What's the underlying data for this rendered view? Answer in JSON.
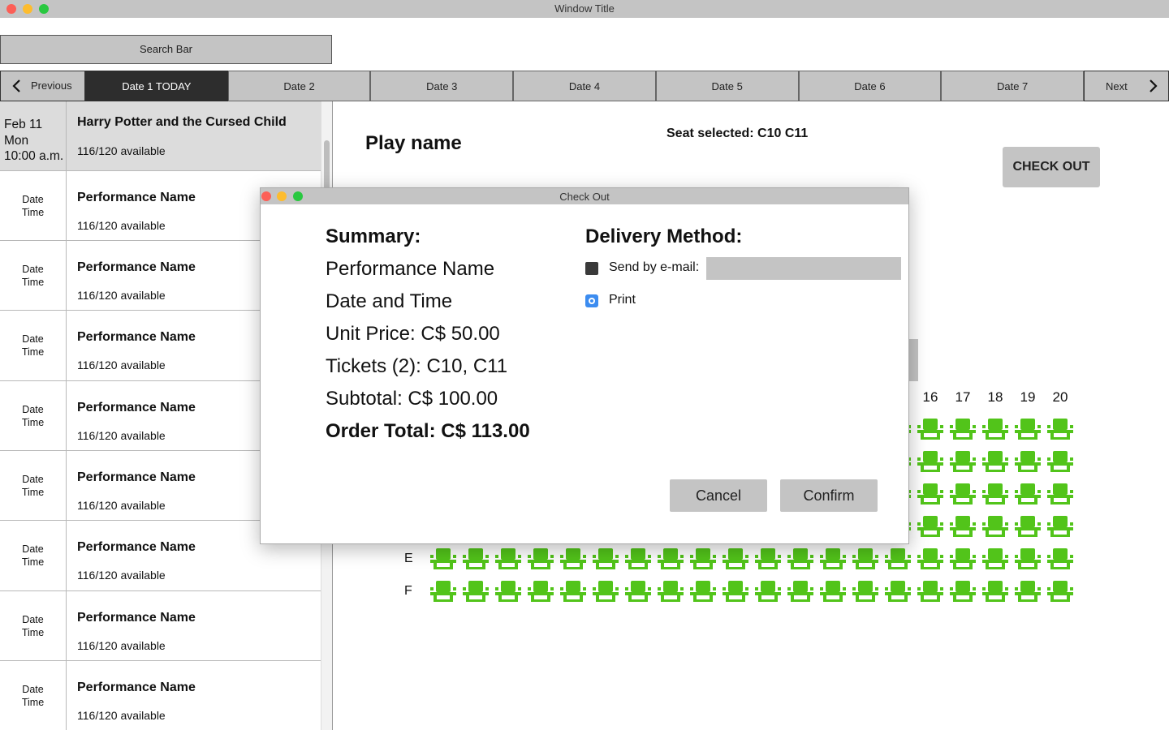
{
  "window": {
    "title": "Window Title"
  },
  "search": {
    "label": "Search Bar"
  },
  "date_nav": {
    "previous_label": "Previous",
    "next_label": "Next",
    "tabs": [
      "Date 1 TODAY",
      "Date 2",
      "Date 3",
      "Date 4",
      "Date 5",
      "Date 6",
      "Date 7"
    ],
    "active_index": 0
  },
  "performances": [
    {
      "date": "Feb 11",
      "day": "Mon",
      "time": "10:00 a.m.",
      "name": "Harry Potter and the Cursed Child",
      "availability": "116/120 available",
      "selected": true
    },
    {
      "date": "Date",
      "time": "Time",
      "name": "Performance Name",
      "availability": "116/120 available"
    },
    {
      "date": "Date",
      "time": "Time",
      "name": "Performance Name",
      "availability": "116/120 available"
    },
    {
      "date": "Date",
      "time": "Time",
      "name": "Performance Name",
      "availability": "116/120 available"
    },
    {
      "date": "Date",
      "time": "Time",
      "name": "Performance Name",
      "availability": "116/120 available"
    },
    {
      "date": "Date",
      "time": "Time",
      "name": "Performance Name",
      "availability": "116/120 available"
    },
    {
      "date": "Date",
      "time": "Time",
      "name": "Performance Name",
      "availability": "116/120 available"
    },
    {
      "date": "Date",
      "time": "Time",
      "name": "Performance Name",
      "availability": "116/120 available"
    },
    {
      "date": "Date",
      "time": "Time",
      "name": "Performance Name",
      "availability": "116/120 available"
    }
  ],
  "main": {
    "play_name": "Play name",
    "seat_selected": "Seat selected:  C10 C11",
    "checkout_label": "CHECK OUT"
  },
  "seat_map": {
    "visible_seat_numbers": [
      "16",
      "17",
      "18",
      "19",
      "20"
    ],
    "visible_row_labels": [
      "E",
      "F"
    ],
    "seat_color": "#52c41a"
  },
  "modal": {
    "title": "Check Out",
    "summary_heading": "Summary:",
    "summary_lines": [
      "Performance Name",
      "Date and Time",
      "Unit Price: C$ 50.00",
      "Tickets (2): C10, C11",
      "Subtotal: C$ 100.00"
    ],
    "order_total": "Order Total: C$ 113.00",
    "delivery_heading": "Delivery Method:",
    "email_label": "Send by e-mail:",
    "email_value": "",
    "print_label": "Print",
    "cancel_label": "Cancel",
    "confirm_label": "Confirm"
  }
}
